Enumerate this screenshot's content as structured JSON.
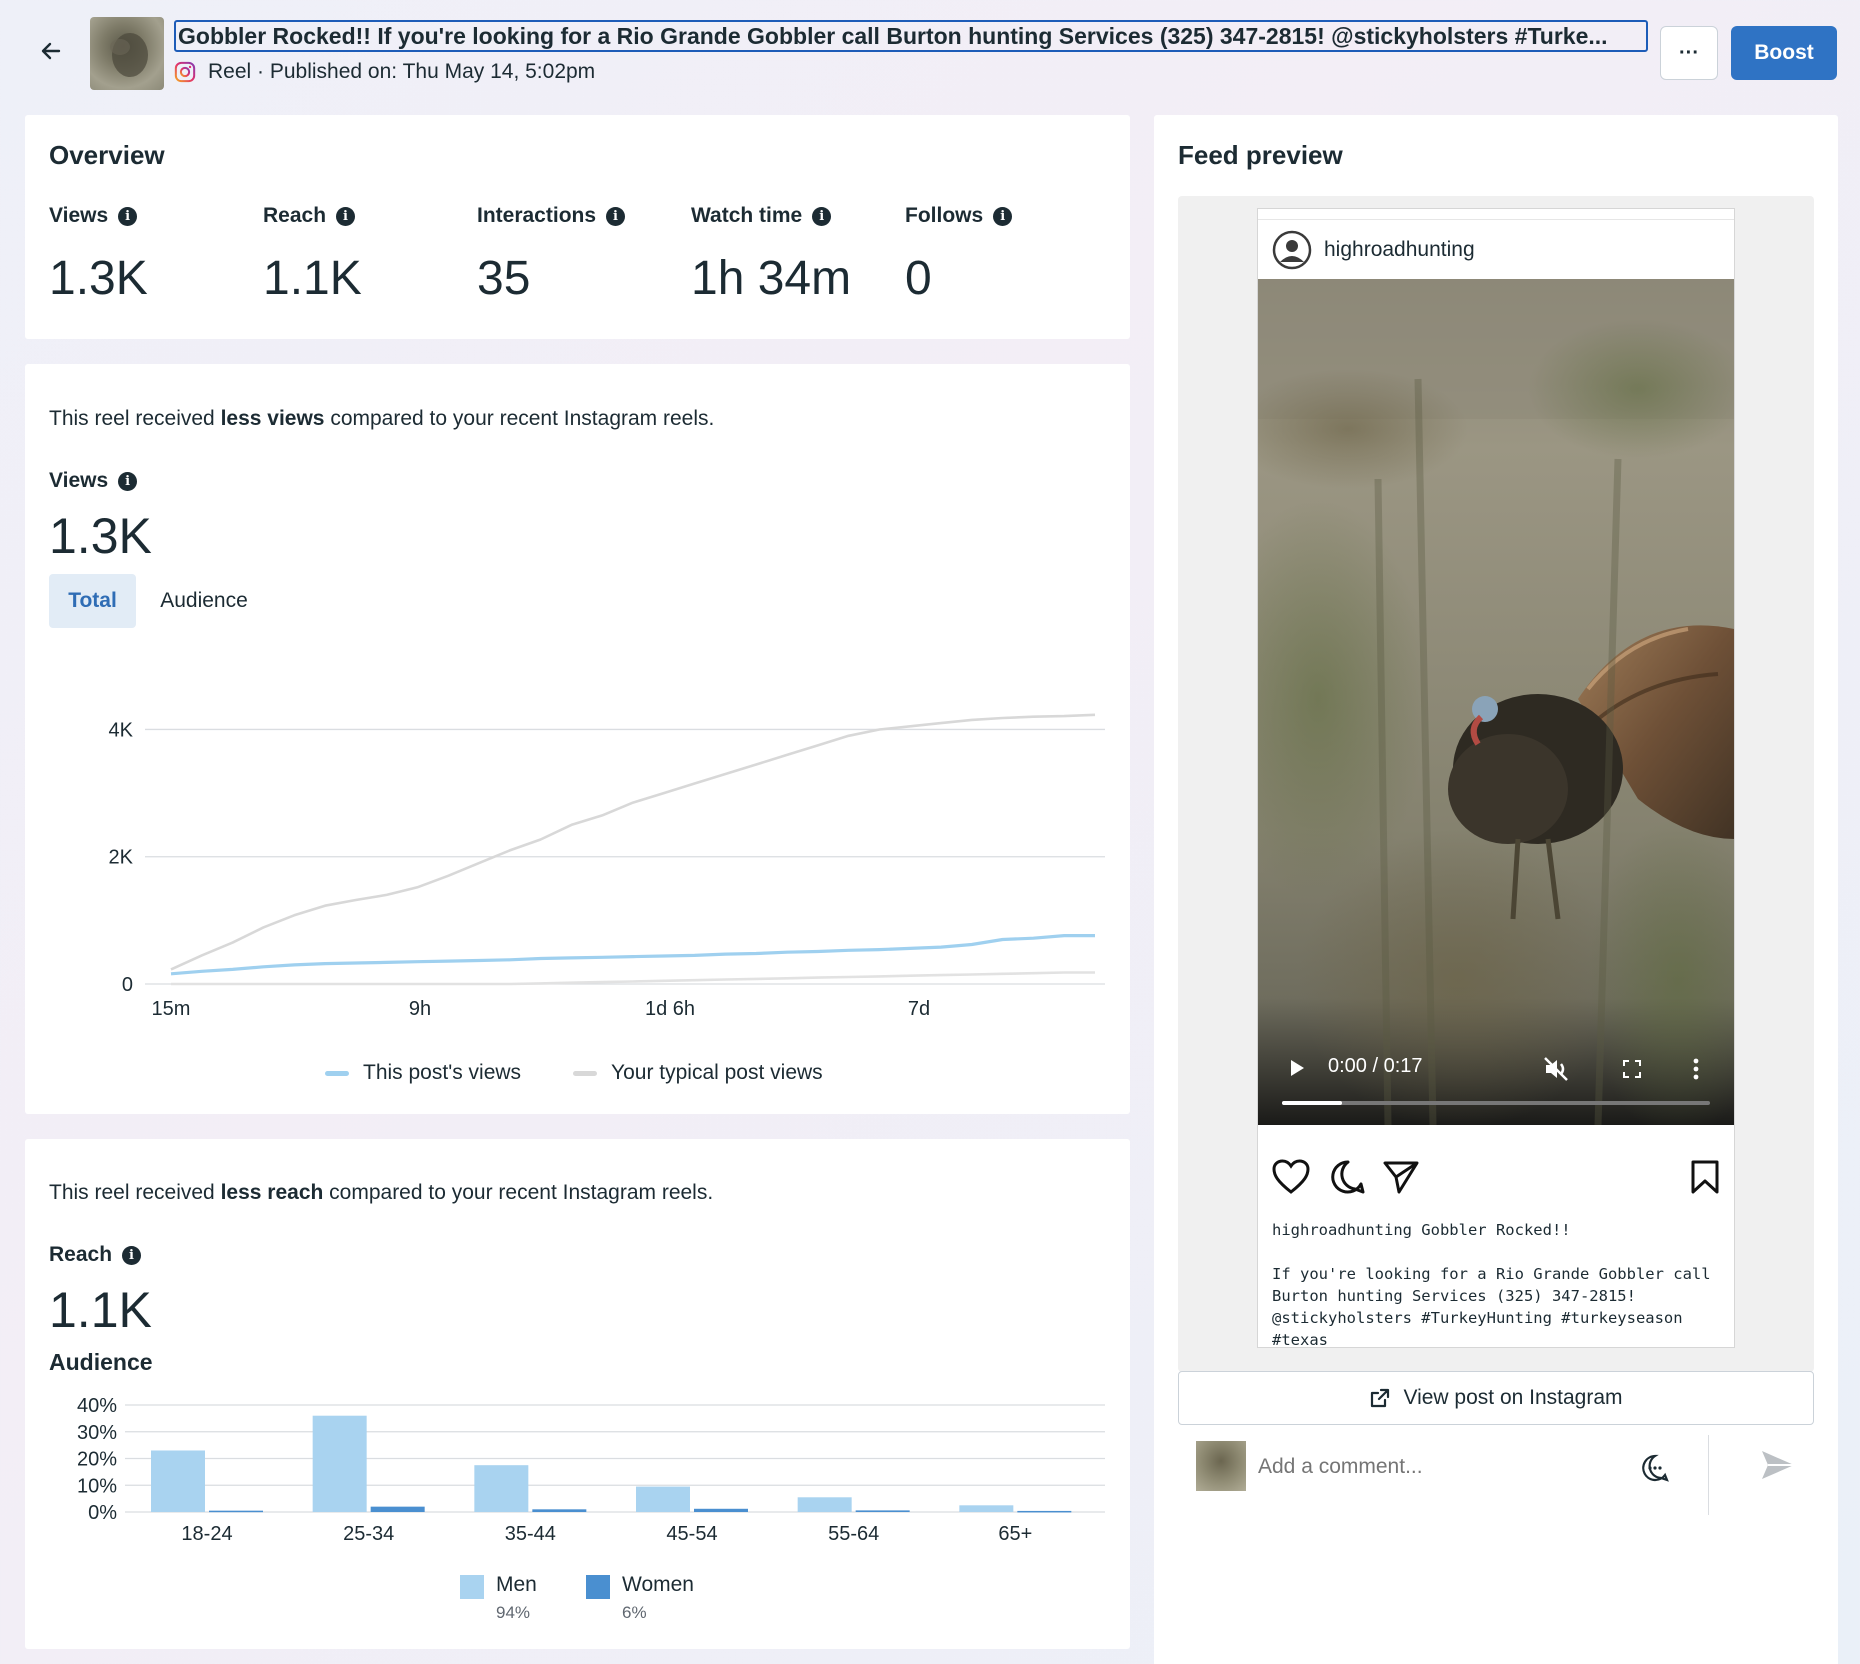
{
  "header": {
    "title": "Gobbler Rocked!! If you're looking for a Rio Grande Gobbler call Burton hunting Services (325) 347-2815! @stickyholsters #Turke...",
    "subtitle": "Reel · Published on: Thu May 14, 5:02pm",
    "more_label": "···",
    "boost_label": "Boost"
  },
  "overview": {
    "title": "Overview",
    "metrics": [
      {
        "label": "Views",
        "value": "1.3K"
      },
      {
        "label": "Reach",
        "value": "1.1K"
      },
      {
        "label": "Interactions",
        "value": "35"
      },
      {
        "label": "Watch time",
        "value": "1h 34m"
      },
      {
        "label": "Follows",
        "value": "0"
      }
    ]
  },
  "views_section": {
    "compare_pre": "This reel received ",
    "compare_bold": "less views",
    "compare_post": " compared to your recent Instagram reels.",
    "label": "Views",
    "value": "1.3K",
    "tabs": [
      "Total",
      "Audience"
    ]
  },
  "reach_section": {
    "compare_pre": "This reel received ",
    "compare_bold": "less reach",
    "compare_post": " compared to your recent Instagram reels.",
    "label": "Reach",
    "value": "1.1K",
    "audience_title": "Audience",
    "legend": [
      {
        "name": "Men",
        "share": "94%",
        "color": "#a9d3f0"
      },
      {
        "name": "Women",
        "share": "6%",
        "color": "#4a8fd0"
      }
    ]
  },
  "chart_data": [
    {
      "type": "line",
      "x_ticks": [
        "15m",
        "9h",
        "1d 6h",
        "7d"
      ],
      "y_ticks": [
        "0",
        "2K",
        "4K"
      ],
      "ylim": [
        0,
        4400
      ],
      "grid": true,
      "legend_position": "bottom",
      "series": [
        {
          "name": "This post's views",
          "color": "#9fd0ef",
          "values": [
            160,
            200,
            230,
            270,
            300,
            320,
            330,
            340,
            350,
            360,
            370,
            380,
            400,
            410,
            420,
            430,
            440,
            450,
            470,
            480,
            500,
            510,
            530,
            540,
            560,
            580,
            620,
            700,
            720,
            760,
            760
          ]
        },
        {
          "name": "Your typical post views",
          "color": "#d8d8d8",
          "values": [
            230,
            450,
            650,
            890,
            1080,
            1230,
            1320,
            1400,
            1520,
            1700,
            1900,
            2100,
            2270,
            2500,
            2650,
            2850,
            3000,
            3150,
            3300,
            3450,
            3600,
            3750,
            3900,
            4000,
            4050,
            4100,
            4150,
            4180,
            4200,
            4210,
            4230
          ]
        },
        {
          "name": "",
          "color": "#e2e2e2",
          "values": [
            0,
            0,
            0,
            0,
            0,
            0,
            0,
            0,
            0,
            0,
            0,
            0,
            10,
            20,
            30,
            40,
            50,
            60,
            70,
            80,
            90,
            100,
            110,
            120,
            130,
            140,
            150,
            160,
            170,
            180,
            180
          ]
        }
      ]
    },
    {
      "type": "bar",
      "categories": [
        "18-24",
        "25-34",
        "35-44",
        "45-54",
        "55-64",
        "65+"
      ],
      "y_ticks": [
        "0%",
        "10%",
        "20%",
        "30%",
        "40%"
      ],
      "ylim": [
        0,
        40
      ],
      "grid": true,
      "series": [
        {
          "name": "Men",
          "color": "#a9d3f0",
          "values": [
            23,
            36,
            17.5,
            9.5,
            5.5,
            2.5
          ]
        },
        {
          "name": "Women",
          "color": "#4a8fd0",
          "values": [
            0.5,
            2,
            1,
            1.2,
            0.6,
            0.4
          ]
        }
      ]
    }
  ],
  "feed": {
    "title": "Feed preview",
    "username": "highroadhunting",
    "video_time": "0:00 / 0:17",
    "video_progress": 0.14,
    "caption_line1": "highroadhunting Gobbler Rocked!!",
    "caption_line2": "If you're looking for a Rio Grande Gobbler call Burton hunting Services (325) 347-2815! @stickyholsters #TurkeyHunting #turkeyseason #texas",
    "view_post_label": "View post on Instagram",
    "comment_placeholder": "Add a comment..."
  }
}
